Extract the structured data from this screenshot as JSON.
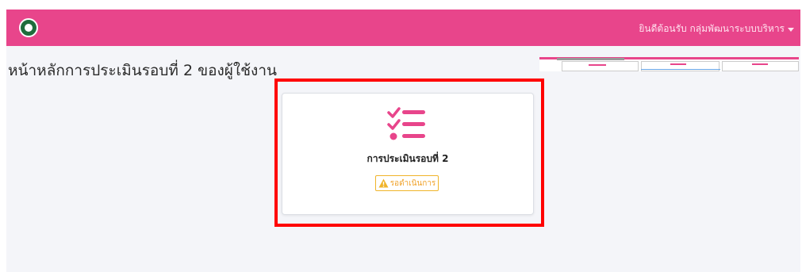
{
  "navbar": {
    "logo_icon": "ministry-seal-icon",
    "user_menu_label": "ยินดีต้อนรับ กลุ่มพัฒนาระบบบริหาร",
    "background_color": "#e8458b"
  },
  "main": {
    "title": "หน้าหลักการประเมินรอบที่ 2 ของผู้ใช้งาน"
  },
  "card": {
    "icon": "checklist-icon",
    "title": "การประเมินรอบที่ 2",
    "status": {
      "icon": "warning-icon",
      "label": "รอดำเนินการ",
      "color": "#f0b42a"
    }
  },
  "highlight_color": "#ff0000"
}
